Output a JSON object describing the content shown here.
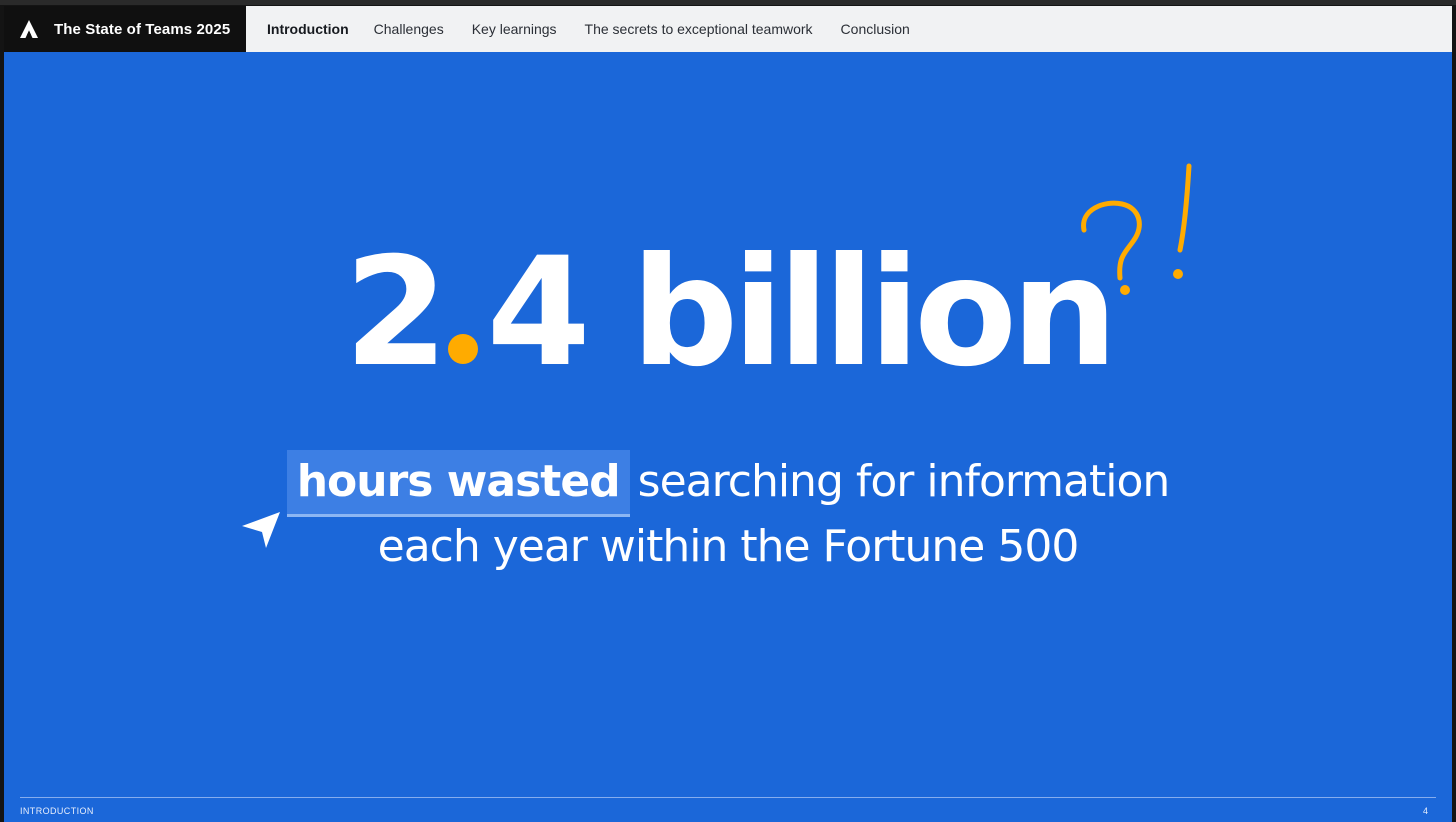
{
  "brand": {
    "title": "The State of Teams 2025",
    "logo_icon": "atlassian-logo-icon"
  },
  "nav": {
    "items": [
      {
        "label": "Introduction",
        "active": true
      },
      {
        "label": "Challenges",
        "active": false
      },
      {
        "label": "Key learnings",
        "active": false
      },
      {
        "label": "The secrets to exceptional teamwork",
        "active": false
      },
      {
        "label": "Conclusion",
        "active": false
      }
    ]
  },
  "slide": {
    "stat_int": "2",
    "stat_frac": "4 billion",
    "highlight": "hours wasted",
    "line1_rest": "searching for information",
    "line2": "each year within the Fortune 500",
    "footer_section": "INTRODUCTION",
    "page_number": "4"
  },
  "colors": {
    "slide_bg": "#1b67d9",
    "accent": "#ffab00",
    "highlight_bg": "#3d7fe4",
    "nav_bg": "#f1f2f3",
    "brand_bg": "#101010"
  },
  "decorations": {
    "cursor_icon": "pointer-arrow-icon",
    "doodle_icon": "question-exclamation-doodle-icon"
  }
}
